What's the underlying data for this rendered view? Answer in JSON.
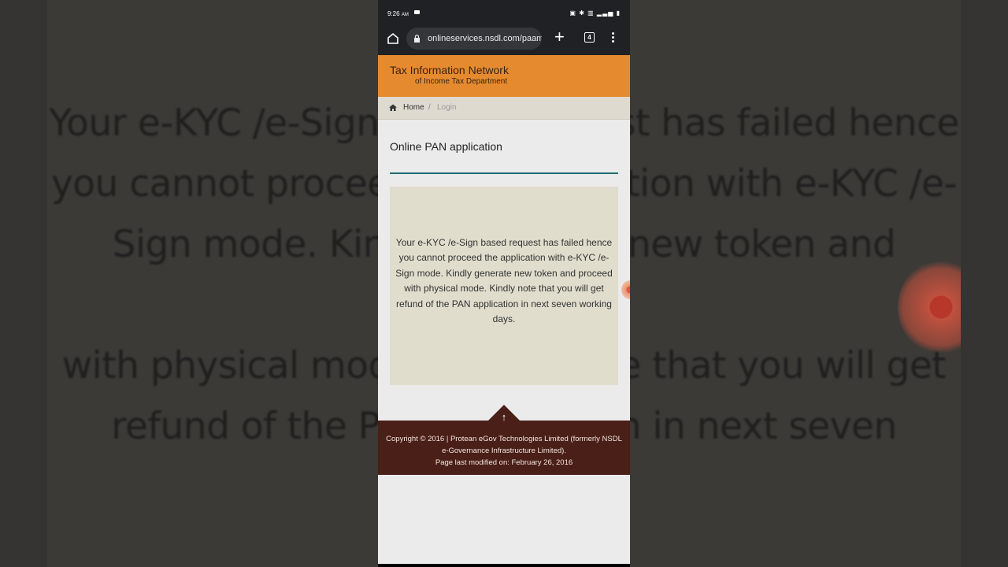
{
  "background": {
    "blurred_text_lines": [
      "Your e-KYC /e-Sign based request has failed hence",
      "you cannot proceed the application with e-KYC /e-",
      "Sign mode. Kindly generate new token and proceed",
      "with physical mode. Kindly note that you will get",
      "refund of the PAN application in next seven working"
    ]
  },
  "status_bar": {
    "time": "9:26",
    "ampm": "AM"
  },
  "browser": {
    "url": "onlineservices.nsdl.com/paam",
    "tab_count": "4"
  },
  "site": {
    "title": "Tax Information Network",
    "subtitle": "of Income Tax Department"
  },
  "breadcrumb": {
    "home": "Home",
    "separator": "/",
    "current": "Login"
  },
  "page": {
    "heading": "Online PAN application",
    "message": "Your e-KYC /e-Sign based request has failed hence you cannot proceed the application with e-KYC /e-Sign mode. Kindly generate new token and proceed with physical mode. Kindly note that you will get refund of the PAN application in next seven working days."
  },
  "footer": {
    "arrow": "↑",
    "copyright": "Copyright © 2016 | Protean eGov Technologies Limited (formerly NSDL e-Governance Infrastructure Limited).",
    "modified": "Page last modified on: February 26, 2016"
  },
  "colors": {
    "header_orange": "#e68a30",
    "footer_brown": "#4a1f17",
    "heading_rule": "#1f6e76",
    "message_box": "#e0ddcd"
  }
}
